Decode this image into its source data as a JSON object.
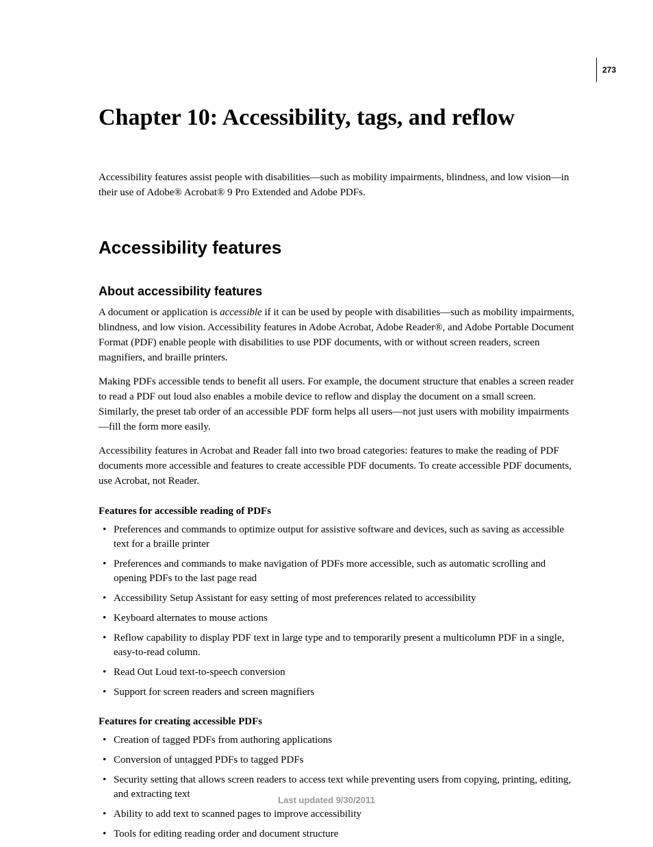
{
  "page_number": "273",
  "chapter_title": "Chapter 10: Accessibility, tags, and reflow",
  "intro": "Accessibility features assist people with disabilities—such as mobility impairments, blindness, and low vision—in their use of Adobe® Acrobat® 9 Pro Extended and Adobe PDFs.",
  "section_title": "Accessibility features",
  "subsection_title": "About accessibility features",
  "para1_a": "A document or application is ",
  "para1_em": "accessible",
  "para1_b": " if it can be used by people with disabilities—such as mobility impairments, blindness, and low vision. Accessibility features in Adobe Acrobat, Adobe Reader®, and Adobe Portable Document Format (PDF) enable people with disabilities to use PDF documents, with or without screen readers, screen magnifiers, and braille printers.",
  "para2": "Making PDFs accessible tends to benefit all users. For example, the document structure that enables a screen reader to read a PDF out loud also enables a mobile device to reflow and display the document on a small screen. Similarly, the preset tab order of an accessible PDF form helps all users—not just users with mobility impairments—fill the form more easily.",
  "para3": "Accessibility features in Acrobat and Reader fall into two broad categories: features to make the reading of PDF documents more accessible and features to create accessible PDF documents. To create accessible PDF documents, use Acrobat, not Reader.",
  "list1_heading": "Features for accessible reading of PDFs",
  "list1": [
    "Preferences and commands to optimize output for assistive software and devices, such as saving as accessible text for a braille printer",
    "Preferences and commands to make navigation of PDFs more accessible, such as automatic scrolling and opening PDFs to the last page read",
    "Accessibility Setup Assistant for easy setting of most preferences related to accessibility",
    "Keyboard alternates to mouse actions",
    "Reflow capability to display PDF text in large type and to temporarily present a multicolumn PDF in a single, easy-to-read column.",
    "Read Out Loud text-to-speech conversion",
    "Support for screen readers and screen magnifiers"
  ],
  "list2_heading": "Features for creating accessible PDFs",
  "list2": [
    "Creation of tagged PDFs from authoring applications",
    "Conversion of untagged PDFs to tagged PDFs",
    "Security setting that allows screen readers to access text while preventing users from copying, printing, editing, and extracting text",
    "Ability to add text to scanned pages to improve accessibility",
    "Tools for editing reading order and document structure"
  ],
  "footer": "Last updated 9/30/2011"
}
